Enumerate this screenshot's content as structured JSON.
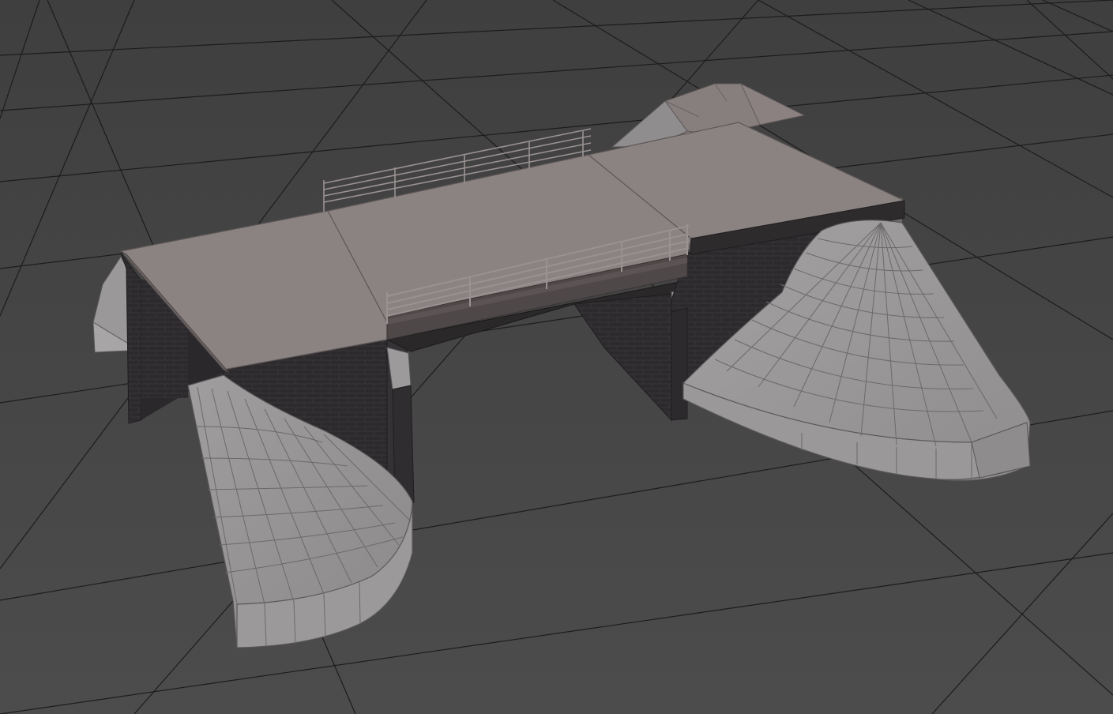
{
  "viewport": {
    "background": "#474747",
    "grid_color": "#1c1c1c"
  },
  "model": {
    "deck_color": "#8a8080",
    "deck_edge_color": "#5e5656",
    "brick_color": "#2b292b",
    "brick_line_color": "#3a3639",
    "stone_color": "#9c9a9a",
    "stone_dark_color": "#8a8888",
    "stone_line_color": "#5a5858",
    "rail_color": "#9a9292"
  }
}
